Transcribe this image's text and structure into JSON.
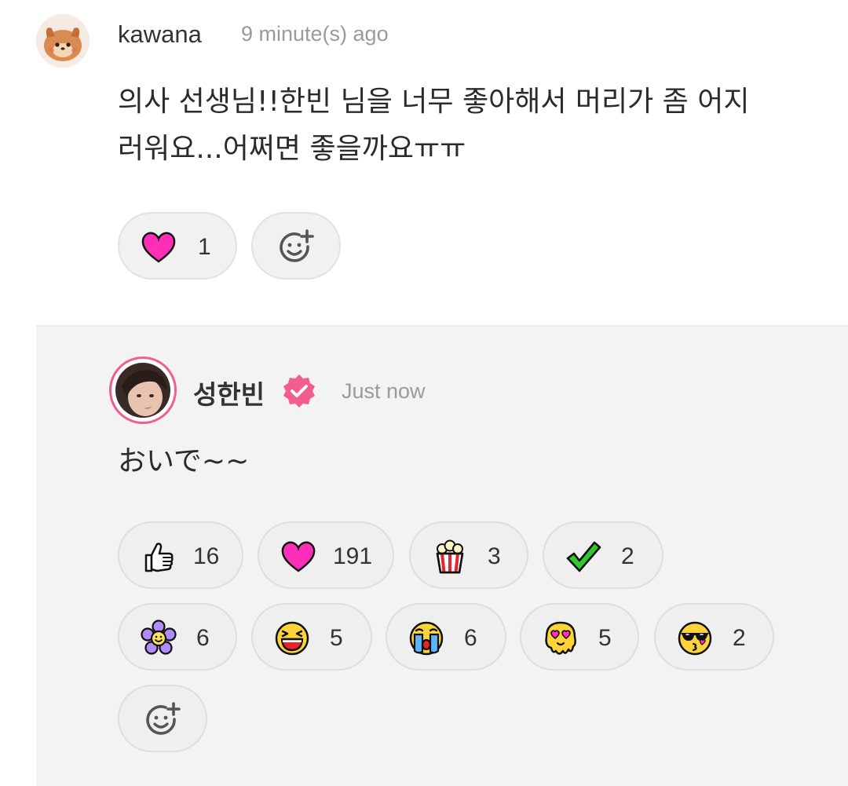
{
  "comment": {
    "username": "kawana",
    "time": "9 minute(s) ago",
    "lines": [
      "의사 선생님!!한빈 님을 너무 좋아해서 머리가 좀 어지",
      "러워요...어쩌면 좋을까요ㅠㅠ"
    ],
    "reactions": [
      {
        "icon": "heart-icon",
        "count": "1"
      }
    ]
  },
  "reply": {
    "username": "성한빈",
    "time": "Just now",
    "text": "おいで~~",
    "reactions": [
      {
        "icon": "thumbs-up-icon",
        "count": "16"
      },
      {
        "icon": "heart-icon",
        "count": "191"
      },
      {
        "icon": "popcorn-icon",
        "count": "3"
      },
      {
        "icon": "checkmark-icon",
        "count": "2"
      },
      {
        "icon": "flower-icon",
        "count": "6"
      },
      {
        "icon": "laughing-face-icon",
        "count": "5"
      },
      {
        "icon": "crying-face-icon",
        "count": "6"
      },
      {
        "icon": "melting-heart-eyes-icon",
        "count": "5"
      },
      {
        "icon": "sunglasses-kiss-icon",
        "count": "2"
      }
    ]
  },
  "colors": {
    "accent": "#f25c8e",
    "heart": "#ff2fb9",
    "reply_bg": "#f3f3f3"
  }
}
